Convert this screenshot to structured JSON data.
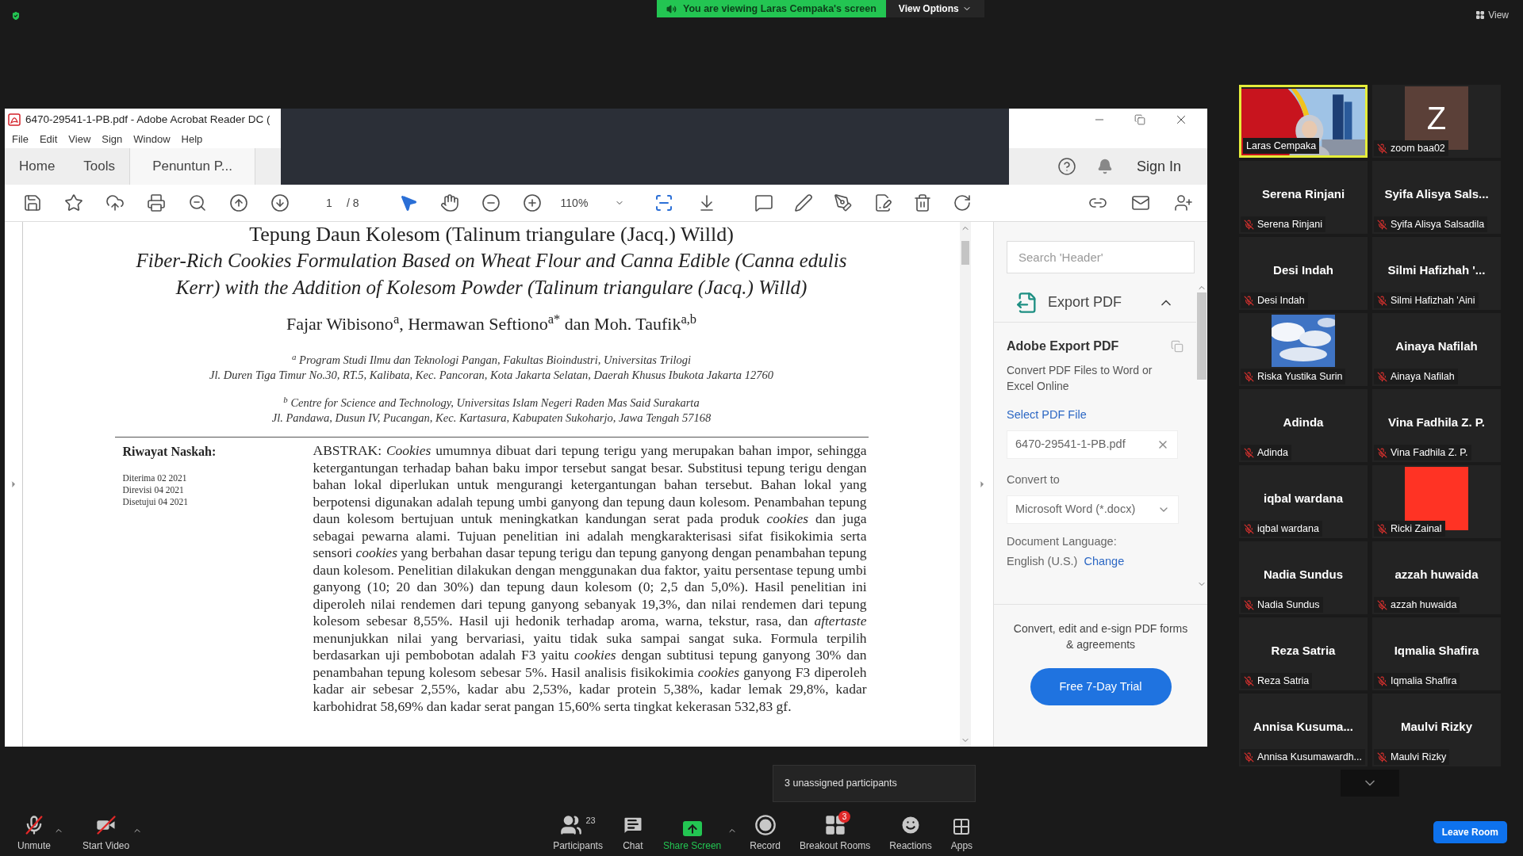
{
  "top_bar": {
    "banner": "You are viewing Laras Cempaka's screen",
    "view_options": "View Options",
    "view": "View"
  },
  "acrobat": {
    "title": "6470-29541-1-PB.pdf - Adobe Acrobat Reader DC (",
    "menu": [
      "File",
      "Edit",
      "View",
      "Sign",
      "Window",
      "Help"
    ],
    "tabs": [
      {
        "label": "Home",
        "selected": false
      },
      {
        "label": "Tools",
        "selected": false
      },
      {
        "label": "Penuntun P...",
        "selected": true
      }
    ],
    "sign_in": "Sign In",
    "page": "1",
    "page_total": "/ 8",
    "zoom": "110%",
    "document": {
      "title_id": "Tepung Daun Kolesom (Talinum triangulare (Jacq.) Willd)",
      "title_en": "Fiber-Rich Cookies Formulation Based on Wheat Flour and Canna Edible (Canna edulis Kerr) with the Addition of Kolesom Powder (Talinum triangulare (Jacq.) Willd)",
      "authors": "Fajar Wibisono$^{a}$, Hermawan Seftiono$^{a*}$ dan Moh. Taufik$^{a,b}$",
      "affiliations": [
        [
          "$^{a}$ Program Studi Ilmu dan Teknologi Pangan, Fakultas Bioindustri, Universitas Trilogi",
          "Jl. Duren Tiga Timur No.30, RT.5, Kalibata, Kec. Pancoran, Kota Jakarta Selatan, Daerah Khusus Ibukota Jakarta 12760"
        ],
        [
          "$^{b}$ Centre for Science and Technology, Universitas Islam Negeri Raden Mas Said Surakarta",
          "Jl. Pandawa, Dusun IV, Pucangan, Kec. Kartasura, Kabupaten Sukoharjo, Jawa Tengah 57168"
        ]
      ],
      "history_heading": "Riwayat Naskah:",
      "history": [
        "Diterima 02 2021",
        "Direvisi 04 2021",
        "Disetujui 04 2021"
      ],
      "abstract": "ABSTRAK: *Cookies* umumnya dibuat dari tepung terigu yang merupakan bahan impor, sehingga ketergantungan terhadap bahan baku impor tersebut sangat besar. Substitusi tepung terigu dengan bahan lokal diperlukan untuk mengurangi ketergantungan bahan tersebut. Bahan lokal yang berpotensi digunakan adalah tepung umbi ganyong dan tepung daun kolesom. Penambahan tepung daun kolesom bertujuan untuk meningkatkan kandungan serat pada produk *cookies* dan juga sebagai pewarna alami. Tujuan penelitian ini adalah mengkarakterisasi sifat fisikokimia serta sensori *cookies* yang berbahan dasar tepung terigu dan tepung ganyong dengan penambahan tepung daun kolesom. Penelitian dilakukan dengan menggunakan dua faktor, yaitu persentase tepung umbi ganyong (10; 20 dan 30%) dan tepung daun kolesom (0; 2,5 dan 5,0%). Hasil penelitian ini diperoleh nilai rendemen dari tepung ganyong sebanyak 19,3%, dan nilai rendemen dari tepung kolesom sebesar 8,55%. Hasil uji hedonik terhadap aroma, warna, tekstur, rasa, dan *aftertaste* menunjukkan nilai yang bervariasi, yaitu tidak suka sampai sangat suka. Formula terpilih berdasarkan uji pembobotan adalah F3 yaitu *cookies* dengan subtitusi tepung ganyong 30% dan penambahan tepung kolesom sebesar 5%. Hasil analisis fisikokimia *cookies* ganyong F3 diperoleh kadar air sebesar 2,55%, kadar abu 2,53%, kadar protein 5,38%, kadar lemak 29,8%, kadar karbohidrat 58,69% dan kadar serat pangan 15,60% serta tingkat kekerasan 532,83 gf."
    },
    "panel": {
      "search_placeholder": "Search 'Header'",
      "section": "Export PDF",
      "expanded": true,
      "heading": "Adobe Export PDF",
      "description": "Convert PDF Files to Word or Excel Online",
      "select_label": "Select PDF File",
      "file": "6470-29541-1-PB.pdf",
      "convert_label": "Convert to",
      "format": "Microsoft Word (*.docx)",
      "language_label": "Document Language:",
      "language": "English (U.S.)",
      "change": "Change",
      "promo": "Convert, edit and e-sign PDF forms & agreements",
      "trial": "Free 7-Day Trial"
    }
  },
  "participants": [
    {
      "kind": "video",
      "label": "Laras Cempaka",
      "speaking": true,
      "muted": false
    },
    {
      "kind": "avatar",
      "initial": "Z",
      "label": "zoom baa02",
      "speaking": false,
      "muted": true
    },
    {
      "kind": "name",
      "heading": "Serena Rinjani",
      "label": "Serena Rinjani",
      "speaking": false,
      "muted": true
    },
    {
      "kind": "name",
      "heading": "Syifa Alisya Sals...",
      "label": "Syifa Alisya Salsadila",
      "speaking": false,
      "muted": true
    },
    {
      "kind": "name",
      "heading": "Desi Indah",
      "label": "Desi Indah",
      "speaking": false,
      "muted": true
    },
    {
      "kind": "name",
      "heading": "Silmi Hafizhah '...",
      "label": "Silmi Hafizhah 'Aini",
      "speaking": false,
      "muted": true
    },
    {
      "kind": "picture",
      "label": "Riska Yustika Surin",
      "speaking": false,
      "muted": true
    },
    {
      "kind": "name",
      "heading": "Ainaya Nafilah",
      "label": "Ainaya Nafilah",
      "speaking": false,
      "muted": true
    },
    {
      "kind": "name",
      "heading": "Adinda",
      "label": "Adinda",
      "speaking": false,
      "muted": true
    },
    {
      "kind": "name",
      "heading": "Vina Fadhila Z. P.",
      "label": "Vina Fadhila Z. P.",
      "speaking": false,
      "muted": true
    },
    {
      "kind": "name",
      "heading": "iqbal wardana",
      "label": "iqbal wardana",
      "speaking": false,
      "muted": true
    },
    {
      "kind": "swatch",
      "color": "#ff3324",
      "label": "Ricki Zainal",
      "speaking": false,
      "muted": true
    },
    {
      "kind": "name",
      "heading": "Nadia Sundus",
      "label": "Nadia Sundus",
      "speaking": false,
      "muted": true
    },
    {
      "kind": "name",
      "heading": "azzah huwaida",
      "label": "azzah huwaida",
      "speaking": false,
      "muted": true
    },
    {
      "kind": "name",
      "heading": "Reza Satria",
      "label": "Reza Satria",
      "speaking": false,
      "muted": true
    },
    {
      "kind": "name",
      "heading": "Iqmalia Shafira",
      "label": "Iqmalia Shafira",
      "speaking": false,
      "muted": true
    },
    {
      "kind": "name",
      "heading": "Annisa Kusuma...",
      "label": "Annisa Kusumawardh...",
      "speaking": false,
      "muted": true
    },
    {
      "kind": "name",
      "heading": "Maulvi Rizky",
      "label": "Maulvi Rizky",
      "speaking": false,
      "muted": true
    }
  ],
  "tooltip": "3 unassigned participants",
  "controls": [
    {
      "kind": "mic",
      "label": "Unmute"
    },
    {
      "kind": "video",
      "label": "Start Video"
    },
    {
      "kind": "participants",
      "label": "Participants",
      "count": "23"
    },
    {
      "kind": "chat",
      "label": "Chat"
    },
    {
      "kind": "share",
      "label": "Share Screen"
    },
    {
      "kind": "record",
      "label": "Record"
    },
    {
      "kind": "breakout",
      "label": "Breakout Rooms",
      "badge": "3"
    },
    {
      "kind": "reactions",
      "label": "Reactions"
    },
    {
      "kind": "apps",
      "label": "Apps"
    }
  ],
  "leave": "Leave Room"
}
